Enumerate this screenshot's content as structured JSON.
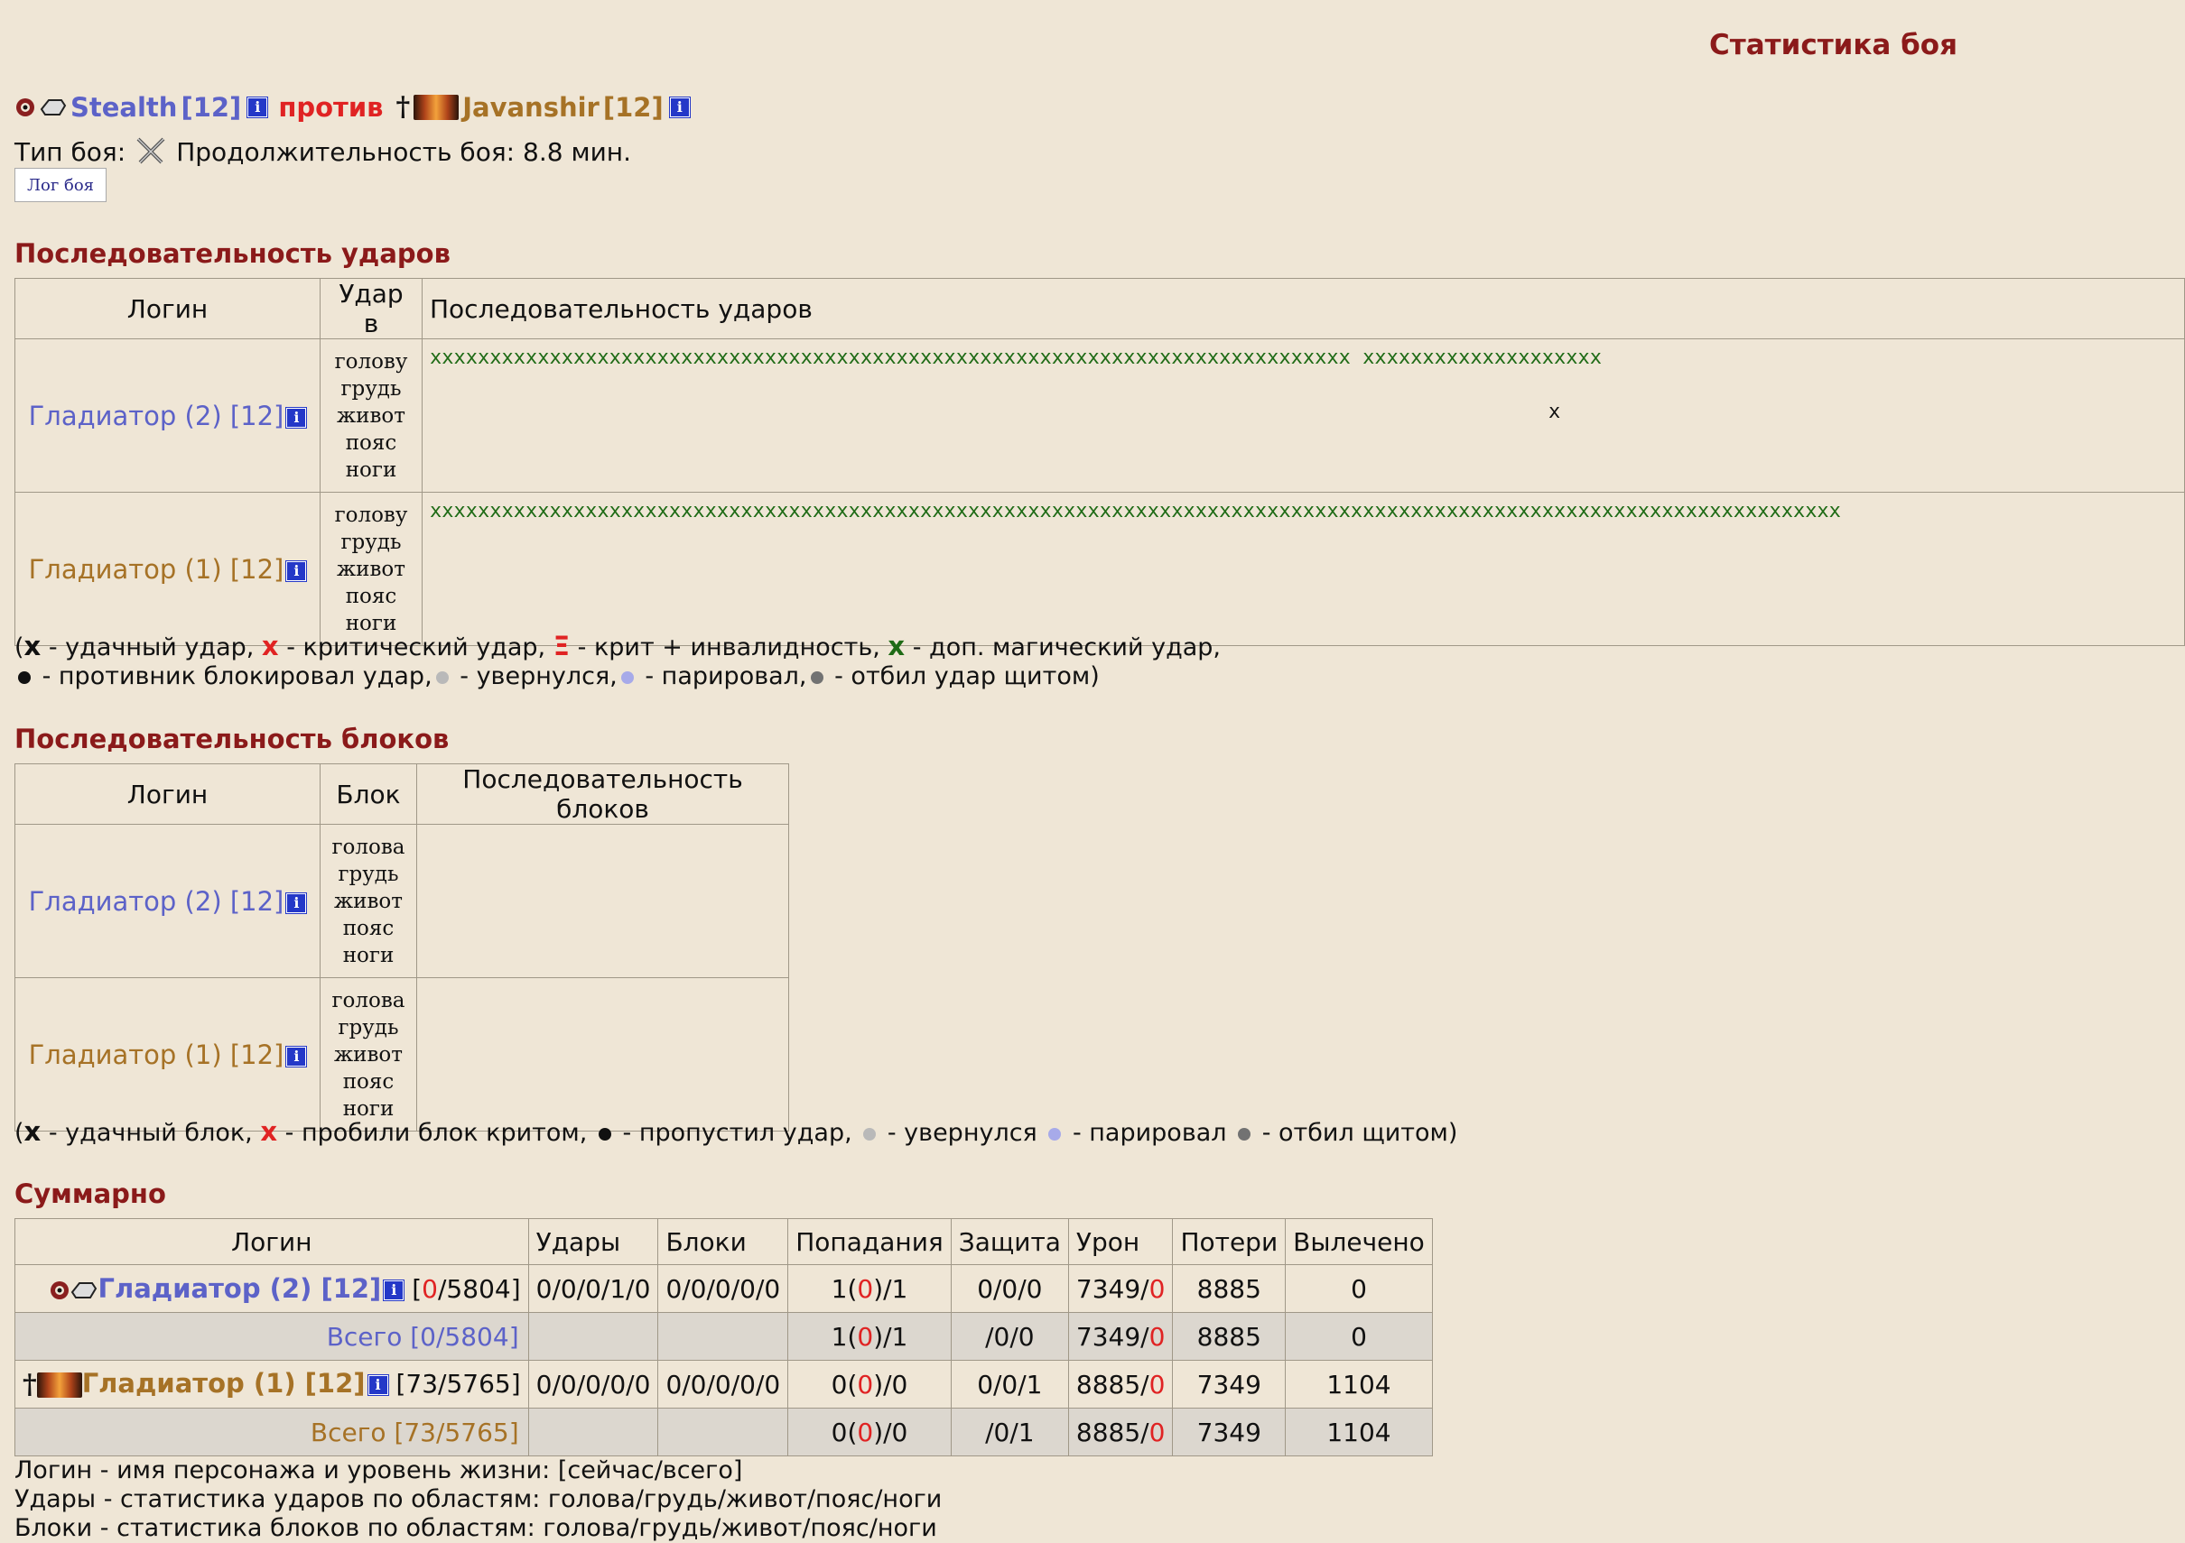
{
  "page_title": "Статистика боя",
  "fighters": {
    "left": {
      "name": "Stealth",
      "level": "[12]",
      "icon": "gear-icon"
    },
    "versus": "против",
    "right": {
      "name": "Javanshir",
      "level": "[12]",
      "icon": "banner-icon"
    }
  },
  "battle": {
    "type_label": "Тип боя:",
    "duration": "Продолжительность боя: 8.8 мин.",
    "log_button": "Лог боя"
  },
  "colors": {
    "blue_team": "#5c62c8",
    "brown_team": "#a67226",
    "section_title": "#8b1a1a",
    "hit_green": "#1f6b16",
    "crit_red": "#e02323"
  },
  "hits": {
    "title": "Последовательность ударов",
    "headers": [
      "Логин",
      "Удар в",
      "Последовательность ударов"
    ],
    "zones": [
      "голову",
      "грудь",
      "живот",
      "пояс",
      "ноги"
    ],
    "rows": [
      {
        "login": "Гладиатор (2) [12]",
        "seq_head": "xxxxxxxxxxxxxxxxxxxxxxxxxxxxxxxxxxxxxxxxxxxxxxxxxxxxxxxxxxxxxxxxxxxxxxxxxxxxx xxxxxxxxxxxxxxxxxxxx",
        "seq_belt": "x"
      },
      {
        "login": "Гладиатор (1) [12]",
        "seq_head": "xxxxxxxxxxxxxxxxxxxxxxxxxxxxxxxxxxxxxxxxxxxxxxxxxxxxxxxxxxxxxxxxxxxxxxxxxxxxxxxxxxxxxxxxxxxxxxxxxxxxxxxxxxxxxxxxxxxxxx"
      }
    ],
    "legend_line1": {
      "a": "x",
      "a_text": " - удачный удар, ",
      "b": "x",
      "b_text": " - критический удар, ",
      "c": "Ξ",
      "c_text": " - крит + инвалидность, ",
      "d": "x",
      "d_text": " - доп. магический удар,"
    },
    "legend_line2": {
      "a": " - противник блокировал удар,",
      "b": " - увернулся,",
      "c": " - парировал,",
      "d": " - отбил удар щитом)"
    }
  },
  "blocks": {
    "title": "Последовательность блоков",
    "headers": [
      "Логин",
      "Блок",
      "Последовательность блоков"
    ],
    "zones": [
      "голова",
      "грудь",
      "живот",
      "пояс",
      "ноги"
    ],
    "rows": [
      {
        "login": "Гладиатор (2) [12]"
      },
      {
        "login": "Гладиатор (1) [12]"
      }
    ],
    "legend": {
      "a": "x",
      "a_text": " - удачный блок, ",
      "b": "x",
      "b_text": " - пробили блок критом, ",
      "c": " - пропустил удар, ",
      "d": " - увернулся ",
      "e": " - парировал ",
      "f": " - отбил щитом)"
    }
  },
  "summary": {
    "title": "Суммарно",
    "headers": [
      "Логин",
      "Удары",
      "Блоки",
      "Попадания",
      "Защита",
      "Урон",
      "Потери",
      "Вылечено"
    ],
    "rows": [
      {
        "login": "Гладиатор (2) [12]",
        "hp_open": "[",
        "hp_now": "0",
        "hp_total": "/5804]",
        "hits": "0/0/0/1/0",
        "blocks": "0/0/0/0/0",
        "hit_a": "1(",
        "hit_b": "0",
        "hit_c": ")/1",
        "defense": "0/0/0",
        "dmg_a": "7349/",
        "dmg_b": "0",
        "loss": "8885",
        "healed": "0"
      },
      {
        "total": "Всего [0/5804]",
        "hit_a": "1(",
        "hit_b": "0",
        "hit_c": ")/1",
        "defense": "/0/0",
        "dmg_a": "7349/",
        "dmg_b": "0",
        "loss": "8885",
        "healed": "0"
      },
      {
        "login": "Гладиатор (1) [12]",
        "hp": "[73/5765]",
        "hits": "0/0/0/0/0",
        "blocks": "0/0/0/0/0",
        "hit_a": "0(",
        "hit_b": "0",
        "hit_c": ")/0",
        "defense": "0/0/1",
        "dmg_a": "8885/",
        "dmg_b": "0",
        "loss": "7349",
        "healed": "1104"
      },
      {
        "total": "Всего [73/5765]",
        "hit_a": "0(",
        "hit_b": "0",
        "hit_c": ")/0",
        "defense": "/0/1",
        "dmg_a": "8885/",
        "dmg_b": "0",
        "loss": "7349",
        "healed": "1104"
      }
    ]
  },
  "footnotes": [
    "Логин - имя персонажа и уровень жизни: [сейчас/всего]",
    "Удары - статистика ударов по областям: голова/грудь/живот/пояс/ноги",
    "Блоки - статистика блоков по областям: голова/грудь/живот/пояс/ноги"
  ]
}
